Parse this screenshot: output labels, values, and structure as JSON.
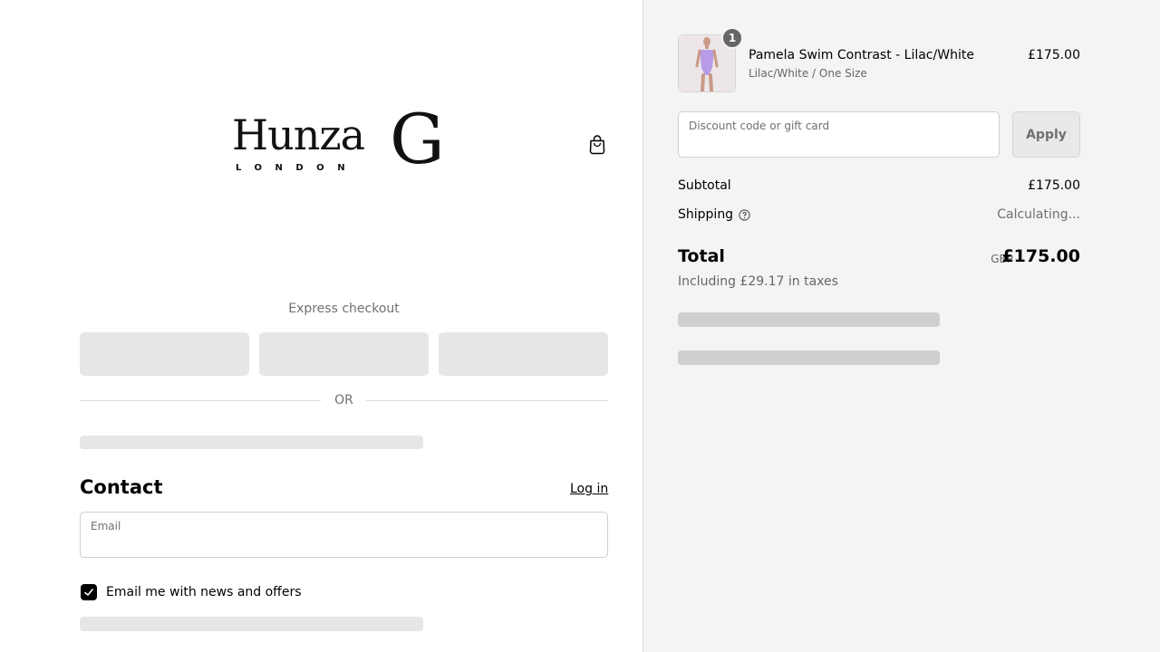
{
  "brand": {
    "logo_main": "Hunza",
    "logo_letter": "G",
    "logo_sub": "LONDON"
  },
  "header": {
    "cart_icon": "shopping-bag-icon"
  },
  "express_checkout": {
    "title": "Express checkout",
    "divider_text": "OR"
  },
  "contact": {
    "title": "Contact",
    "login_label": "Log in",
    "email_label": "Email",
    "email_value": "",
    "newsletter_label": "Email me with news and offers",
    "newsletter_checked": true
  },
  "order": {
    "item": {
      "name": "Pamela Swim Contrast - Lilac/White",
      "variant": "Lilac/White / One Size",
      "price": "£175.00",
      "quantity": "1"
    },
    "discount": {
      "placeholder": "Discount code or gift card",
      "apply_label": "Apply"
    },
    "subtotal_label": "Subtotal",
    "subtotal_value": "£175.00",
    "shipping_label": "Shipping",
    "shipping_value": "Calculating...",
    "total_label": "Total",
    "total_currency": "GBP",
    "total_value": "£175.00",
    "taxes_note": "Including £29.17 in taxes"
  },
  "colors": {
    "sidebar_bg": "#f4f4f4",
    "skeleton": "#e6e6e6",
    "checkbox": "#000000",
    "product_swatch": "#b79be6"
  }
}
